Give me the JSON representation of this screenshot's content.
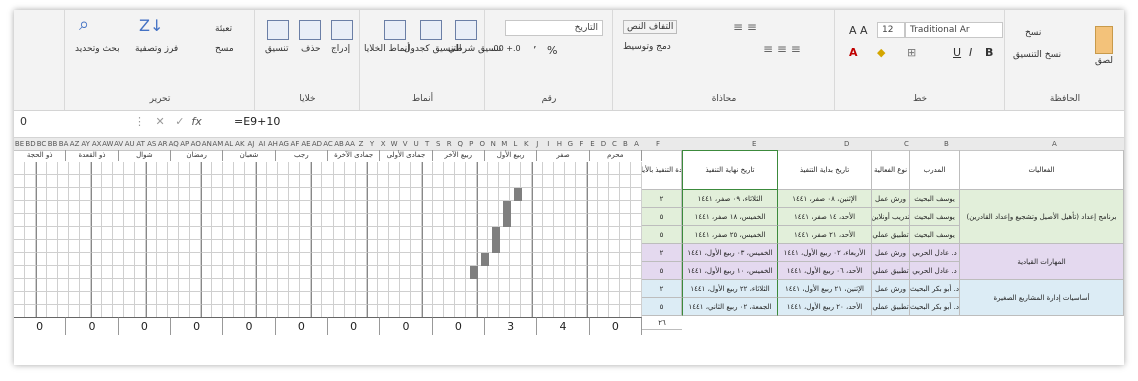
{
  "ribbon": {
    "clipboard": {
      "label": "الحافظة",
      "copy": "نسخ",
      "format_painter": "نسخ التنسيق",
      "paste": "لصق"
    },
    "font": {
      "label": "خط",
      "font_name": "Traditional Ar",
      "font_size": "12",
      "bold": "B",
      "italic": "I",
      "underline": "U"
    },
    "alignment": {
      "label": "محاذاة",
      "merge": "دمج وتوسيط",
      "wrap": "التفاف النص"
    },
    "number": {
      "label": "رقم",
      "format": "التاريخ",
      "percent": "%",
      "comma": "٬",
      "inc_dec": ".00 +.0"
    },
    "styles": {
      "label": "أنماط",
      "conditional": "تنسيق شرطي",
      "as_table": "التنسيق كجدول",
      "cell_styles": "أنماط الخلايا"
    },
    "cells": {
      "label": "خلايا",
      "insert": "إدراج",
      "delete": "حذف",
      "format": "تنسيق"
    },
    "editing": {
      "label": "تحرير",
      "fill": "تعبئة",
      "clear": "مسح",
      "sort": "فرز وتصفية",
      "find": "بحث وتحديد"
    }
  },
  "formula_bar": {
    "name_box": "0",
    "fx": "fx",
    "formula": "=E9+10"
  },
  "headers": {
    "activities": "الفعاليات",
    "trainer": "المدرب",
    "activity_type": "نوع الفعالية",
    "start_date": "تاريخ بداية التنفيذ",
    "end_date": "تاريخ نهاية التنفيذ",
    "days": "مدة التنفيذ بالأيام"
  },
  "column_letters": [
    "A",
    "B",
    "C",
    "D",
    "E",
    "F",
    "G",
    "H",
    "I",
    "J",
    "K",
    "L",
    "M",
    "N",
    "O",
    "P",
    "Q",
    "R",
    "S",
    "T",
    "U",
    "V",
    "W",
    "X",
    "Y",
    "Z",
    "AA",
    "AB",
    "AC",
    "AD",
    "AE",
    "AF",
    "AG",
    "AH",
    "AI",
    "AJ",
    "AK",
    "AL",
    "AM",
    "AN",
    "AO",
    "AP",
    "AQ",
    "AR",
    "AS",
    "AT",
    "AU",
    "AV",
    "AW",
    "AX",
    "AY",
    "AZ",
    "BA",
    "BB",
    "BC",
    "BD",
    "BE"
  ],
  "months": [
    "محرم",
    "صفر",
    "ربيع الأول",
    "ربيع الآخر",
    "جمادى الأولى",
    "جمادى الآخرة",
    "رجب",
    "شعبان",
    "رمضان",
    "شوال",
    "ذو القعدة",
    "ذو الحجة"
  ],
  "groups": [
    {
      "name": "برنامج إعداد (تأهيل الأصيل وتشجيع وإعداد القادرين)"
    },
    {
      "name": "المهارات القيادية"
    },
    {
      "name": "أساسيات إدارة المشاريع الصغيرة"
    }
  ],
  "rows": [
    {
      "trainer": "يوسف البحيث",
      "type": "ورش عمل",
      "start": "الإثنين، ٠٨ صفر، ١٤٤١",
      "end": "الثلاثاء، ٠٩ صفر، ١٤٤١",
      "days": "٢"
    },
    {
      "trainer": "يوسف البحيث",
      "type": "تدريب أونلاين",
      "start": "الأحد، ١٤ صفر، ١٤٤١",
      "end": "الخميس، ١٨ صفر، ١٤٤١",
      "days": "٥"
    },
    {
      "trainer": "يوسف البحيث",
      "type": "تطبيق عملي",
      "start": "الأحد، ٢١ صفر، ١٤٤١",
      "end": "الخميس، ٢٥ صفر، ١٤٤١",
      "days": "٥"
    },
    {
      "trainer": "د. عادل الحربي",
      "type": "ورش عمل",
      "start": "الأربعاء، ٠٢ ربيع الأول، ١٤٤١",
      "end": "الخميس، ٠٣ ربيع الأول، ١٤٤١",
      "days": "٢"
    },
    {
      "trainer": "د. عادل الحربي",
      "type": "تطبيق عملي",
      "start": "الأحد، ٠٦ ربيع الأول، ١٤٤١",
      "end": "الخميس، ١٠ ربيع الأول، ١٤٤١",
      "days": "٥"
    },
    {
      "trainer": "د. أبو بكر البحيث",
      "type": "ورش عمل",
      "start": "الإثنين، ٢١ ربيع الأول، ١٤٤١",
      "end": "الثلاثاء، ٢٢ ربيع الأول، ١٤٤١",
      "days": "٢"
    },
    {
      "trainer": "د. أبو بكر البحيث",
      "type": "تطبيق عملي",
      "start": "الأحد، ٢٠ ربيع الأول، ١٤٤١",
      "end": "الجمعة، ٠٢ ربيع الثاني، ١٤٤١",
      "days": "٥"
    }
  ],
  "total_days": "٢٦",
  "month_totals": [
    "0",
    "4",
    "3",
    "0",
    "0",
    "0",
    "0",
    "0",
    "0",
    "0",
    "0",
    "0"
  ],
  "colors": {
    "group1": "#e2efda",
    "group2": "#e4d9ef",
    "group3": "#dcecf5",
    "gantt": "#7f7f7f"
  }
}
